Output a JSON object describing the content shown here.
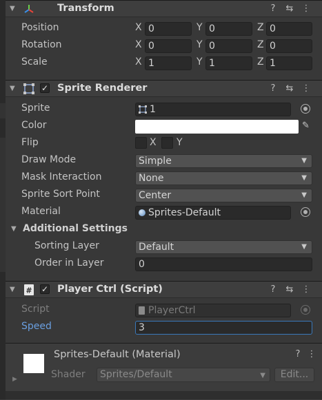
{
  "transform": {
    "title": "Transform",
    "position": {
      "label": "Position",
      "x": "0",
      "y": "0",
      "z": "0"
    },
    "rotation": {
      "label": "Rotation",
      "x": "0",
      "y": "0",
      "z": "0"
    },
    "scale": {
      "label": "Scale",
      "x": "1",
      "y": "1",
      "z": "1"
    },
    "axis_labels": {
      "x": "X",
      "y": "Y",
      "z": "Z"
    }
  },
  "sprite_renderer": {
    "title": "Sprite Renderer",
    "sprite": {
      "label": "Sprite",
      "value": "1"
    },
    "color": {
      "label": "Color",
      "value": "#ffffff"
    },
    "flip": {
      "label": "Flip",
      "x_label": "X",
      "y_label": "Y"
    },
    "draw_mode": {
      "label": "Draw Mode",
      "value": "Simple"
    },
    "mask_interaction": {
      "label": "Mask Interaction",
      "value": "None"
    },
    "sprite_sort_point": {
      "label": "Sprite Sort Point",
      "value": "Center"
    },
    "material": {
      "label": "Material",
      "value": "Sprites-Default"
    },
    "additional_settings": {
      "title": "Additional Settings",
      "sorting_layer": {
        "label": "Sorting Layer",
        "value": "Default"
      },
      "order_in_layer": {
        "label": "Order in Layer",
        "value": "0"
      }
    }
  },
  "player_ctrl": {
    "title": "Player Ctrl (Script)",
    "script": {
      "label": "Script",
      "value": "PlayerCtrl"
    },
    "speed": {
      "label": "Speed",
      "value": "3"
    }
  },
  "material_preview": {
    "name": "Sprites-Default (Material)",
    "shader_label": "Shader",
    "shader_value": "Sprites/Default",
    "edit_label": "Edit..."
  },
  "icons": {
    "help": "help-icon",
    "presets": "presets-icon",
    "menu": "kebab-menu-icon"
  },
  "colors": {
    "background": "#383838",
    "header": "#3e3e3e",
    "focus_border": "#3a79bb",
    "link_label": "#6a9fe0"
  }
}
